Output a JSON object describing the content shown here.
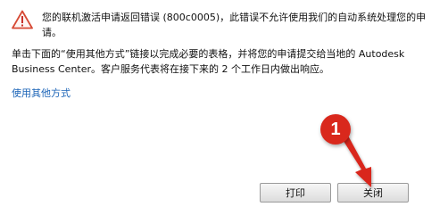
{
  "dialog": {
    "error_message": "您的联机激活申请返回错误 (800c0005)，此错误不允许使用我们的自动系统处理您的申请。",
    "instruction_text": "单击下面的“使用其他方式”链接以完成必要的表格，并将您的申请提交给当地的 Autodesk Business Center。客户服务代表将在接下来的 2 个工作日内做出响应。",
    "alternative_link": "使用其他方式"
  },
  "buttons": {
    "print_label": "打印",
    "close_label": "关闭"
  },
  "annotation": {
    "step_number": "1",
    "color": "#d9281c"
  },
  "icons": {
    "warning": "warning-icon"
  }
}
